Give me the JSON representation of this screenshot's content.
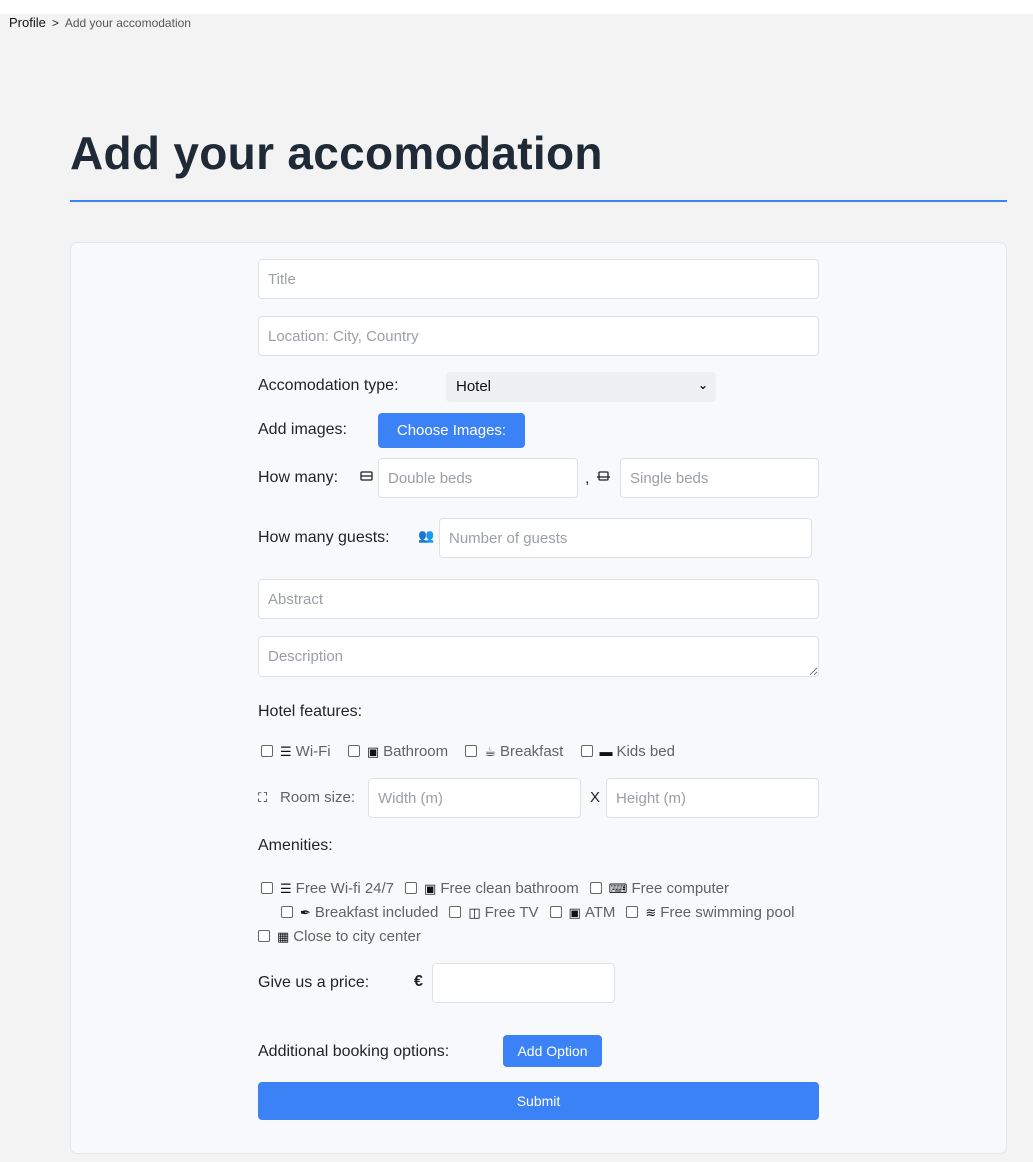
{
  "breadcrumb": {
    "root": "Profile",
    "separator": ">",
    "current": "Add your accomodation"
  },
  "page": {
    "title": "Add your accomodation"
  },
  "form": {
    "title_placeholder": "Title",
    "location_placeholder": "Location: City, Country",
    "type_label": "Accomodation type:",
    "type_value": "Hotel",
    "images_label": "Add images:",
    "images_button": "Choose Images:",
    "howmany_label": "How many:",
    "double_placeholder": "Double beds",
    "comma": ",",
    "single_placeholder": "Single beds",
    "guests_label": "How many guests:",
    "guests_placeholder": "Number of guests",
    "abstract_placeholder": "Abstract",
    "description_placeholder": "Description",
    "features_label": "Hotel features:",
    "features": [
      {
        "label": "Wi-Fi",
        "icon": "wifi-icon"
      },
      {
        "label": "Bathroom",
        "icon": "bath-icon"
      },
      {
        "label": "Breakfast",
        "icon": "cup-icon"
      },
      {
        "label": "Kids bed",
        "icon": "bed-icon"
      }
    ],
    "roomsize_label": "Room size:",
    "width_placeholder": "Width (m)",
    "times": "X",
    "height_placeholder": "Height (m)",
    "amenities_label": "Amenities:",
    "amenities": [
      {
        "label": "Free Wi-fi 24/7",
        "icon": "wifi-icon"
      },
      {
        "label": "Free clean bathroom",
        "icon": "bath-icon"
      },
      {
        "label": "Free computer",
        "icon": "keyboard-icon"
      },
      {
        "label": "Breakfast included",
        "icon": "utensil-icon"
      },
      {
        "label": "Free TV",
        "icon": "tv-icon"
      },
      {
        "label": "ATM",
        "icon": "money-icon"
      },
      {
        "label": "Free swimming pool",
        "icon": "pool-icon"
      },
      {
        "label": "Close to city center",
        "icon": "city-icon"
      }
    ],
    "price_label": "Give us a price:",
    "currency": "€",
    "booking_label": "Additional booking options:",
    "add_option": "Add Option",
    "submit": "Submit"
  }
}
